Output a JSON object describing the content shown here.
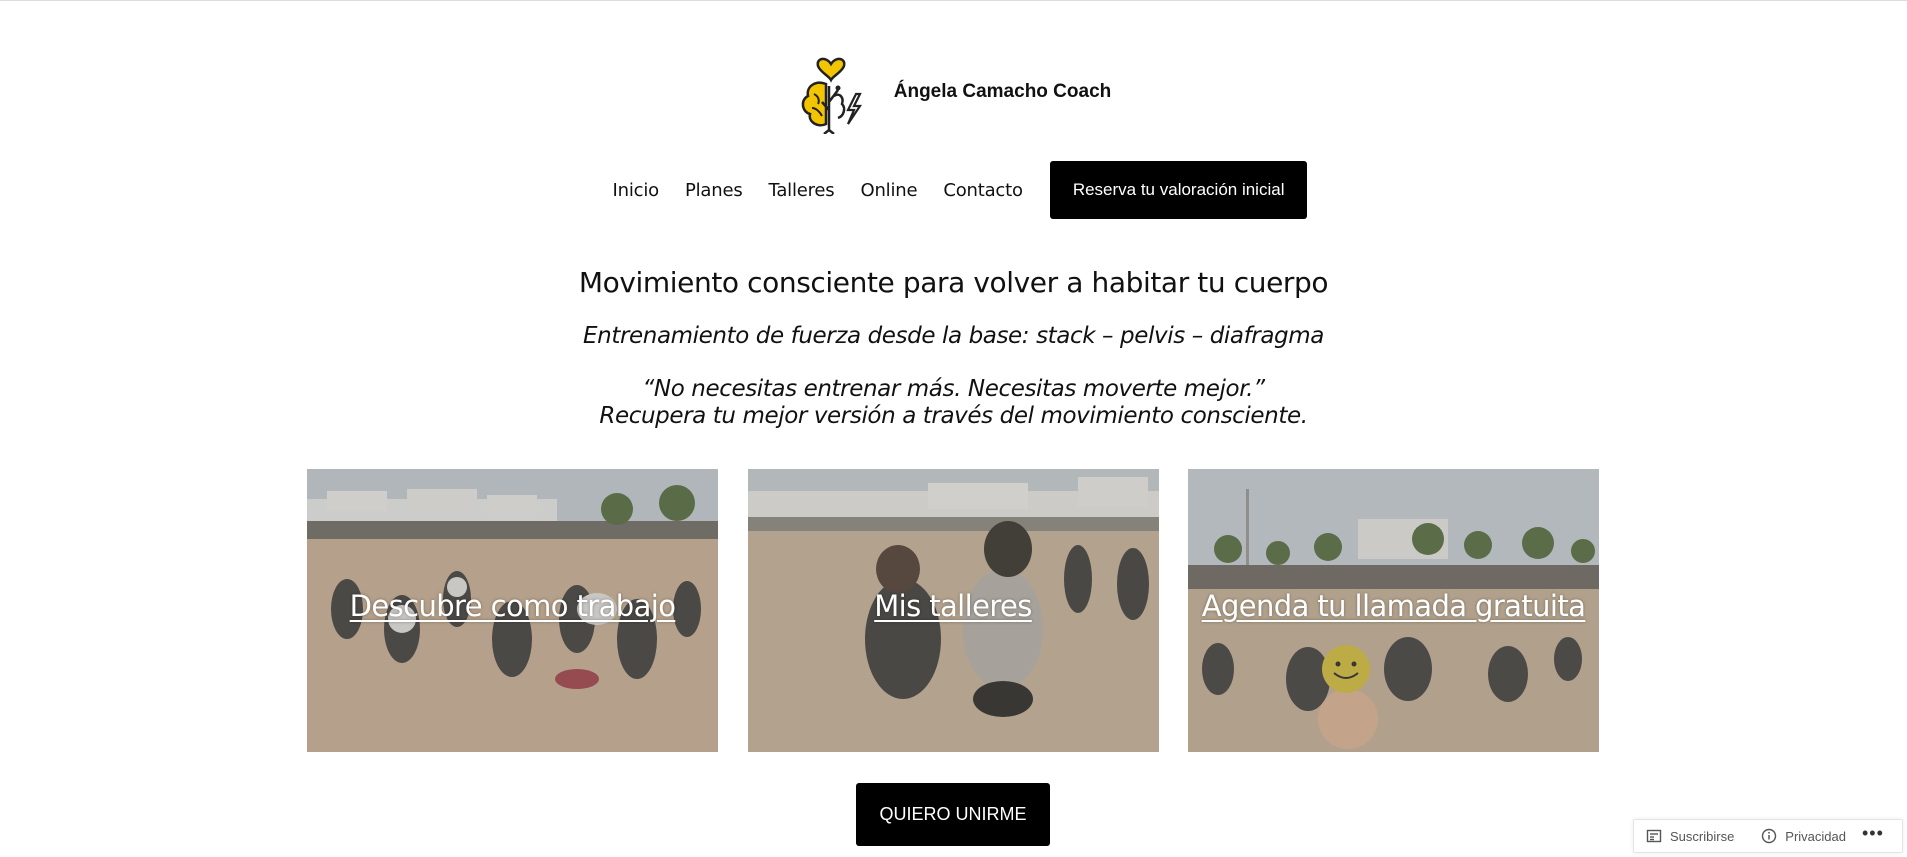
{
  "site": {
    "title": "Ángela Camacho Coach",
    "logo_icon": "brain-heart-logo-icon"
  },
  "nav": {
    "items": [
      {
        "label": "Inicio"
      },
      {
        "label": "Planes"
      },
      {
        "label": "Talleres"
      },
      {
        "label": "Online"
      },
      {
        "label": "Contacto"
      }
    ],
    "cta_label": "Reserva tu valoración inicial"
  },
  "hero": {
    "heading": "Movimiento consciente para volver a habitar tu cuerpo",
    "subheading": "Entrenamiento de fuerza desde la base: stack – pelvis – diafragma",
    "quote_line1": "“No necesitas entrenar más. Necesitas moverte mejor.”",
    "quote_line2": "Recupera tu mejor versión a través del movimiento consciente."
  },
  "cards": [
    {
      "label": "Descubre como trabajo",
      "image": "beach-group-squat-photo"
    },
    {
      "label": "Mis talleres",
      "image": "beach-women-running-photo"
    },
    {
      "label": "Agenda tu llamada gratuita",
      "image": "beach-circle-smiley-ball-photo"
    }
  ],
  "join_button": "QUIERO UNIRME",
  "actionbar": {
    "subscribe_label": "Suscribirse",
    "privacy_label": "Privacidad",
    "more_label": "•••"
  },
  "colors": {
    "button_bg": "#000000",
    "button_text": "#ffffff",
    "logo_yellow": "#f2c500",
    "text": "#111111"
  }
}
